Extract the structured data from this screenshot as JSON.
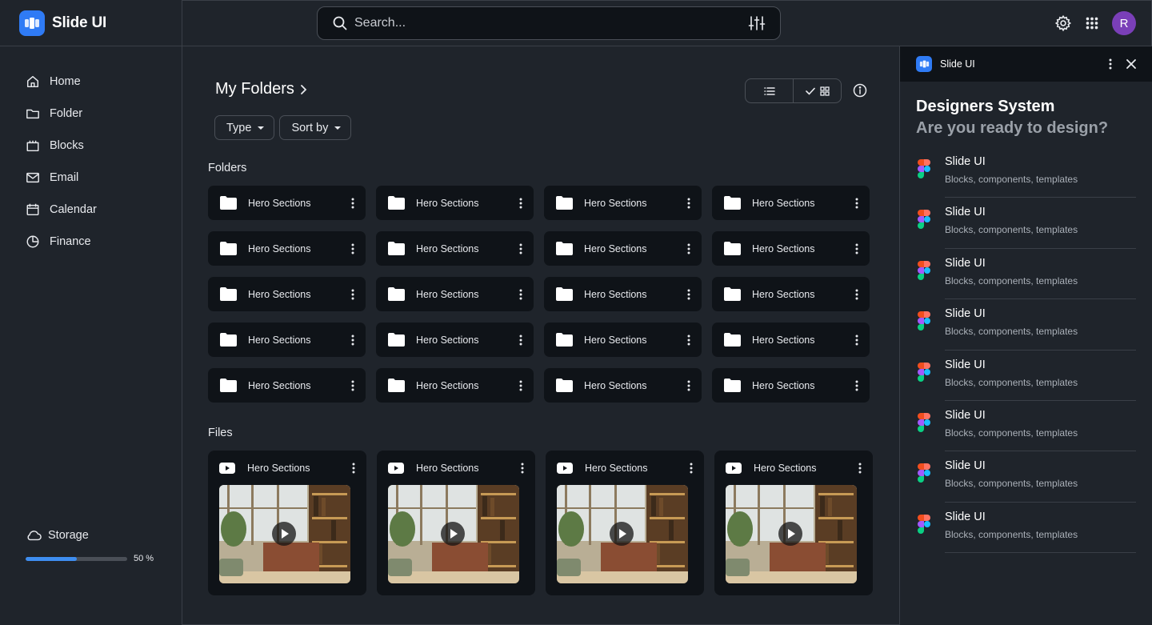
{
  "app": {
    "name": "Slide UI"
  },
  "sidebar": {
    "items": [
      {
        "label": "Home",
        "icon": "home-icon"
      },
      {
        "label": "Folder",
        "icon": "folder-icon"
      },
      {
        "label": "Blocks",
        "icon": "blocks-icon"
      },
      {
        "label": "Email",
        "icon": "email-icon"
      },
      {
        "label": "Calendar",
        "icon": "calendar-icon"
      },
      {
        "label": "Finance",
        "icon": "pie-chart-icon"
      }
    ],
    "storage": {
      "label": "Storage",
      "percent": 50,
      "percent_label": "50 %"
    }
  },
  "header": {
    "search_placeholder": "Search...",
    "avatar_initial": "R"
  },
  "main": {
    "title": "My Folders",
    "filters": {
      "type": "Type",
      "sort": "Sort by"
    },
    "folders_label": "Folders",
    "files_label": "Files",
    "folders": [
      "Hero Sections",
      "Hero Sections",
      "Hero Sections",
      "Hero Sections",
      "Hero Sections",
      "Hero Sections",
      "Hero Sections",
      "Hero Sections",
      "Hero Sections",
      "Hero Sections",
      "Hero Sections",
      "Hero Sections",
      "Hero Sections",
      "Hero Sections",
      "Hero Sections",
      "Hero Sections",
      "Hero Sections",
      "Hero Sections",
      "Hero Sections",
      "Hero Sections"
    ],
    "files": [
      "Hero Sections",
      "Hero Sections",
      "Hero Sections",
      "Hero Sections"
    ]
  },
  "panel": {
    "header_name": "Slide UI",
    "title": "Designers System",
    "subtitle": "Are you ready to design?",
    "items": [
      {
        "title": "Slide UI",
        "subtitle": "Blocks, components, templates"
      },
      {
        "title": "Slide UI",
        "subtitle": "Blocks, components, templates"
      },
      {
        "title": "Slide UI",
        "subtitle": "Blocks, components, templates"
      },
      {
        "title": "Slide UI",
        "subtitle": "Blocks, components, templates"
      },
      {
        "title": "Slide UI",
        "subtitle": "Blocks, components, templates"
      },
      {
        "title": "Slide UI",
        "subtitle": "Blocks, components, templates"
      },
      {
        "title": "Slide UI",
        "subtitle": "Blocks, components, templates"
      },
      {
        "title": "Slide UI",
        "subtitle": "Blocks, components, templates"
      }
    ]
  },
  "colors": {
    "accent": "#2f7bf5",
    "background": "#1f242b",
    "card": "#0f1318",
    "avatar": "#7a3fb8"
  }
}
